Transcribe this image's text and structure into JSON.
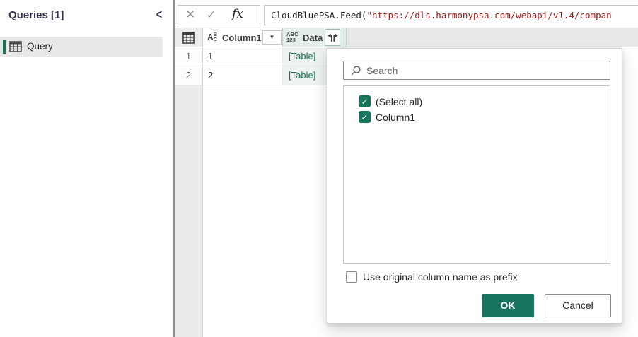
{
  "sidebar": {
    "title": "Queries [1]",
    "collapse_glyph": "<",
    "items": [
      {
        "label": "Query",
        "selected": true
      }
    ]
  },
  "formula_bar": {
    "cancel_glyph": "✕",
    "accept_glyph": "✓",
    "fx_glyph": "fx",
    "formula_function": "CloudBluePSA.Feed(",
    "formula_argument": "\"https://dls.harmonypsa.com/webapi/v1.4/compan"
  },
  "grid": {
    "columns": [
      {
        "name": "Column1",
        "type": "text",
        "type_icon": "abc-text-icon",
        "has_filter": true,
        "filter_glyph": "▼"
      },
      {
        "name": "Data",
        "type": "any",
        "type_icon": "abc123-any-icon",
        "has_expand": true,
        "selected": true
      }
    ],
    "type_icon_parts": {
      "a": "A",
      "b": "B",
      "c": "C",
      "abc": "ABC",
      "num": "123"
    },
    "rows": [
      {
        "num": "1",
        "column1": "1",
        "data": "[Table]"
      },
      {
        "num": "2",
        "column1": "2",
        "data": "[Table]"
      }
    ]
  },
  "expand_popup": {
    "search_placeholder": "Search",
    "options": [
      {
        "label": "(Select all)",
        "checked": true
      },
      {
        "label": "Column1",
        "checked": true
      }
    ],
    "check_glyph": "✓",
    "prefix_option": {
      "label": "Use original column name as prefix",
      "checked": false
    },
    "ok_label": "OK",
    "cancel_label": "Cancel"
  },
  "colors": {
    "accent_teal": "#17735c",
    "table_link": "#17735c",
    "selected_column_header_bg": "#e3eee8",
    "selected_column_cell_bg": "#eef3f0",
    "formula_string_red": "#a31515",
    "sidebar_title": "#32324d"
  }
}
